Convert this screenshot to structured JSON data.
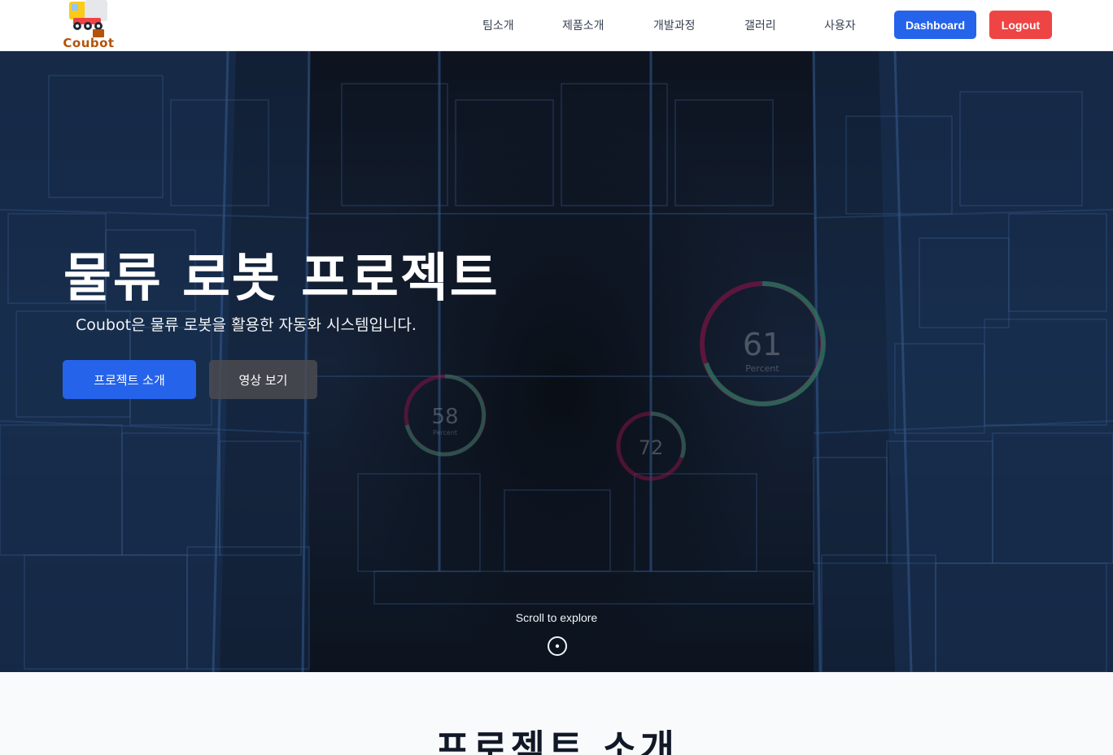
{
  "brand": {
    "name": "Coubot"
  },
  "nav": {
    "links": [
      "팀소개",
      "제품소개",
      "개발과정",
      "갤러리",
      "사용자"
    ],
    "dashboard_label": "Dashboard",
    "logout_label": "Logout"
  },
  "hero": {
    "title": "물류 로봇 프로젝트",
    "subtitle": "Coubot은 물류 로봇을 활용한 자동화 시스템입니다.",
    "primary_button": "프로젝트 소개",
    "secondary_button": "영상 보기",
    "scroll_hint": "Scroll to explore",
    "gauges": [
      {
        "value": "61",
        "label": "Percent"
      },
      {
        "value": "58",
        "label": "Percent"
      },
      {
        "value": "72",
        "label": ""
      }
    ]
  },
  "section": {
    "title": "프로젝트 소개"
  },
  "colors": {
    "primary": "#2563eb",
    "danger": "#ef4444",
    "hero_bg": "#121c2c"
  }
}
